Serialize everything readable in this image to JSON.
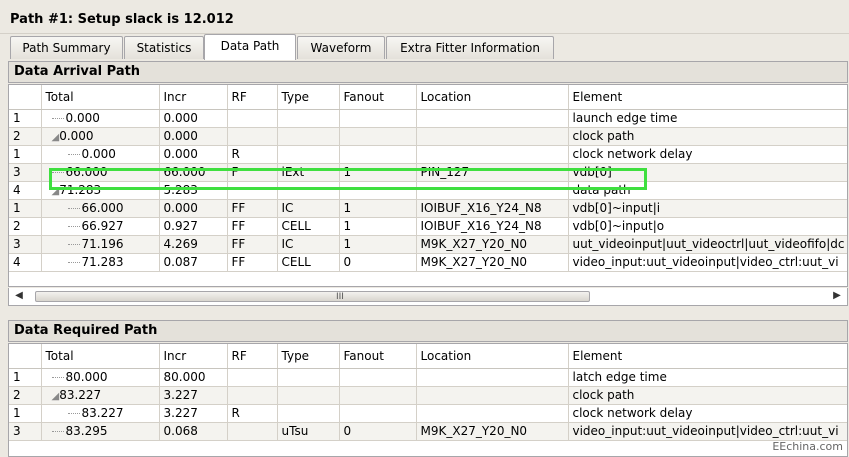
{
  "window": {
    "title": "Path #1: Setup slack is 12.012"
  },
  "tabs": [
    {
      "label": "Path Summary",
      "active": false
    },
    {
      "label": "Statistics",
      "active": false
    },
    {
      "label": "Data Path",
      "active": true
    },
    {
      "label": "Waveform",
      "active": false
    },
    {
      "label": "Extra Fitter Information",
      "active": false
    }
  ],
  "columns": [
    "",
    "Total",
    "Incr",
    "RF",
    "Type",
    "Fanout",
    "Location",
    "Element"
  ],
  "arrival": {
    "title": "Data Arrival Path",
    "rows": [
      {
        "idx": "1",
        "tree": "dots",
        "indent": 0,
        "total": "0.000",
        "incr": "0.000",
        "rf": "",
        "type": "",
        "fanout": "",
        "location": "",
        "element": "launch edge time"
      },
      {
        "idx": "2",
        "tree": "open",
        "indent": 0,
        "total": "0.000",
        "incr": "0.000",
        "rf": "",
        "type": "",
        "fanout": "",
        "location": "",
        "element": "clock path"
      },
      {
        "idx": "1",
        "tree": "dots",
        "indent": 1,
        "total": "0.000",
        "incr": "0.000",
        "rf": "R",
        "type": "",
        "fanout": "",
        "location": "",
        "element": "clock network delay"
      },
      {
        "idx": "3",
        "tree": "dots",
        "indent": 0,
        "total": "66.000",
        "incr": "66.000",
        "rf": "F",
        "type": "iExt",
        "fanout": "1",
        "location": "PIN_127",
        "element": "vdb[0]"
      },
      {
        "idx": "4",
        "tree": "open",
        "indent": 0,
        "total": "71.283",
        "incr": "5.283",
        "rf": "",
        "type": "",
        "fanout": "",
        "location": "",
        "element": "data path"
      },
      {
        "idx": "1",
        "tree": "dots",
        "indent": 1,
        "total": "66.000",
        "incr": "0.000",
        "rf": "FF",
        "type": "IC",
        "fanout": "1",
        "location": "IOIBUF_X16_Y24_N8",
        "element": "vdb[0]~input|i"
      },
      {
        "idx": "2",
        "tree": "dots",
        "indent": 1,
        "total": "66.927",
        "incr": "0.927",
        "rf": "FF",
        "type": "CELL",
        "fanout": "1",
        "location": "IOIBUF_X16_Y24_N8",
        "element": "vdb[0]~input|o"
      },
      {
        "idx": "3",
        "tree": "dots",
        "indent": 1,
        "total": "71.196",
        "incr": "4.269",
        "rf": "FF",
        "type": "IC",
        "fanout": "1",
        "location": "M9K_X27_Y20_N0",
        "element": "uut_videoinput|uut_videoctrl|uut_videofifo|dc"
      },
      {
        "idx": "4",
        "tree": "dots",
        "indent": 1,
        "total": "71.283",
        "incr": "0.087",
        "rf": "FF",
        "type": "CELL",
        "fanout": "0",
        "location": "M9K_X27_Y20_N0",
        "element": "video_input:uut_videoinput|video_ctrl:uut_vi"
      }
    ]
  },
  "required": {
    "title": "Data Required Path",
    "rows": [
      {
        "idx": "1",
        "tree": "dots",
        "indent": 0,
        "total": "80.000",
        "incr": "80.000",
        "rf": "",
        "type": "",
        "fanout": "",
        "location": "",
        "element": "latch edge time"
      },
      {
        "idx": "2",
        "tree": "open",
        "indent": 0,
        "total": "83.227",
        "incr": "3.227",
        "rf": "",
        "type": "",
        "fanout": "",
        "location": "",
        "element": "clock path"
      },
      {
        "idx": "1",
        "tree": "dots",
        "indent": 1,
        "total": "83.227",
        "incr": "3.227",
        "rf": "R",
        "type": "",
        "fanout": "",
        "location": "",
        "element": "clock network delay"
      },
      {
        "idx": "3",
        "tree": "dots",
        "indent": 0,
        "total": "83.295",
        "incr": "0.068",
        "rf": "",
        "type": "uTsu",
        "fanout": "0",
        "location": "M9K_X27_Y20_N0",
        "element": "video_input:uut_videoinput|video_ctrl:uut_vi"
      }
    ]
  },
  "scrollbar": {
    "grip": "III",
    "left_icon": "scroll-left-icon",
    "right_icon": "scroll-right-icon"
  },
  "watermark": "EEchina.com",
  "colors": {
    "highlight": "#3fdf3f",
    "panel_bg": "#ece9e2"
  }
}
